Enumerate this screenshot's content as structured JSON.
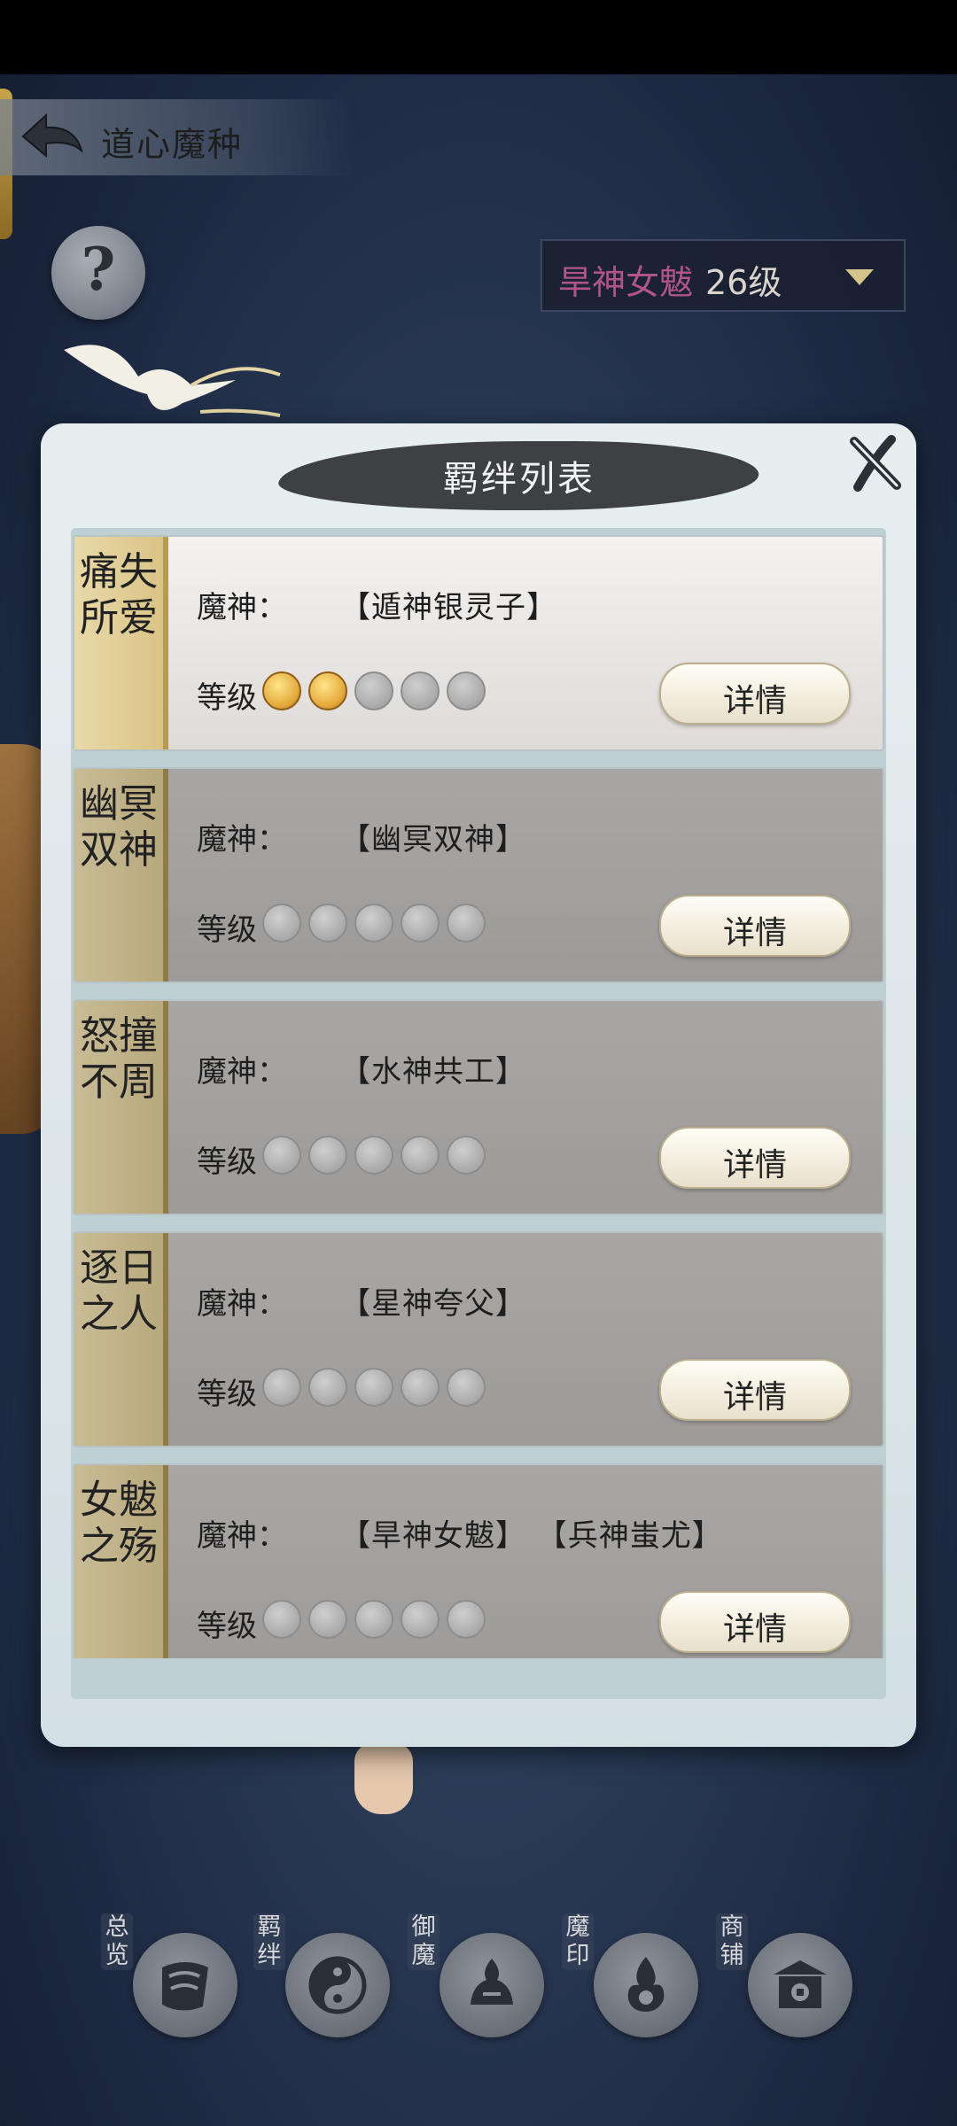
{
  "header": {
    "title": "道心魔种"
  },
  "selector": {
    "name": "旱神女魃",
    "level": "26级"
  },
  "dialog": {
    "title": "羁绊列表",
    "god_label": "魔神：",
    "level_label": "等级",
    "detail_label": "详情"
  },
  "bonds": [
    {
      "tag": "痛失所爱",
      "gods": "【遁神银灵子】",
      "level": 2,
      "max": 5,
      "active": true
    },
    {
      "tag": "幽冥双神",
      "gods": "【幽冥双神】",
      "level": 0,
      "max": 5,
      "active": false
    },
    {
      "tag": "怒撞不周",
      "gods": "【水神共工】",
      "level": 0,
      "max": 5,
      "active": false
    },
    {
      "tag": "逐日之人",
      "gods": "【星神夸父】",
      "level": 0,
      "max": 5,
      "active": false
    },
    {
      "tag": "女魃之殇",
      "gods": "【旱神女魃】 【兵神蚩尤】",
      "level": 0,
      "max": 5,
      "active": false
    }
  ],
  "nav": [
    {
      "label": "总览",
      "icon": "scroll-icon"
    },
    {
      "label": "羁绊",
      "icon": "yin-yang-icon"
    },
    {
      "label": "御魔",
      "icon": "demon-icon"
    },
    {
      "label": "魔印",
      "icon": "flame-seal-icon"
    },
    {
      "label": "商铺",
      "icon": "shop-icon"
    }
  ],
  "colors": {
    "selector_name": "#b0548a",
    "gold": "#d9c486",
    "dialog_bg": "#e7eef0"
  }
}
